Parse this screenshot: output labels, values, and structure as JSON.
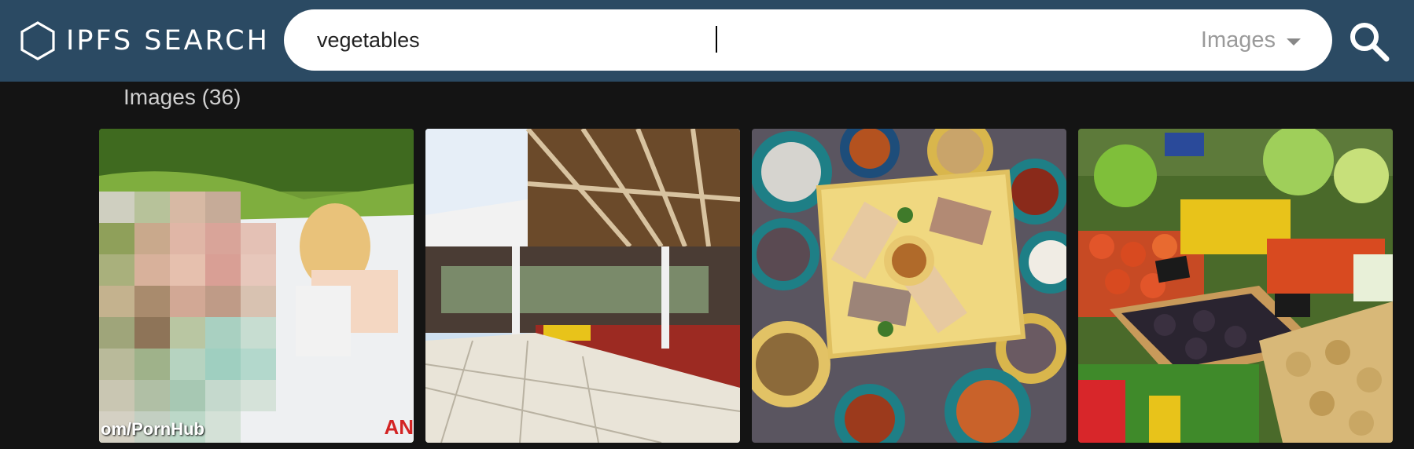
{
  "header": {
    "logo_text": "IPFS SEARCH",
    "logo_icon": "hexagon-icon",
    "search_icon": "search-icon",
    "colors": {
      "bar": "#2b4a63",
      "background": "#141414"
    }
  },
  "search": {
    "query": "vegetables",
    "type_selected": "Images"
  },
  "results": {
    "title": "Images (36)",
    "items": [
      {
        "description": "pixelated-blurred-photo",
        "watermark_left": "om/PornHub",
        "watermark_right": "AN"
      },
      {
        "description": "covered-market-hall"
      },
      {
        "description": "moroccan-food-platter-bowls"
      },
      {
        "description": "vegetable-market-stall"
      }
    ]
  }
}
